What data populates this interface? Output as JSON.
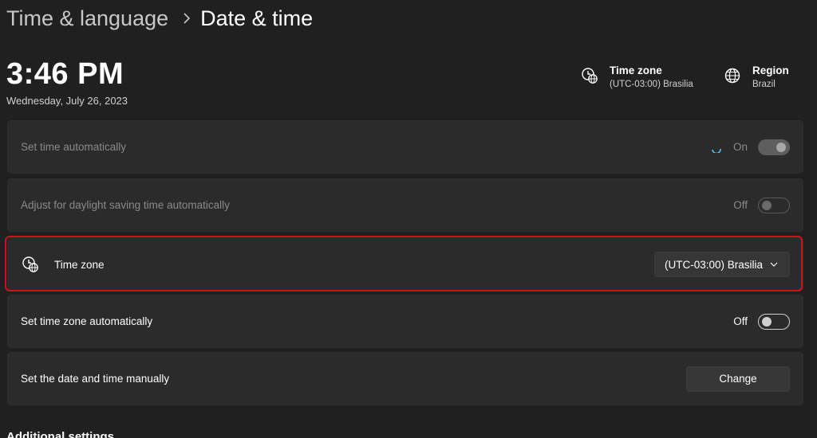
{
  "breadcrumb": {
    "parent": "Time & language",
    "current": "Date & time"
  },
  "clock": {
    "time": "3:46 PM",
    "date": "Wednesday, July 26, 2023"
  },
  "summary": {
    "time_zone": {
      "title": "Time zone",
      "value": "(UTC-03:00) Brasilia",
      "icon": "clock-globe-icon"
    },
    "region": {
      "title": "Region",
      "value": "Brazil",
      "icon": "globe-icon"
    }
  },
  "settings": {
    "set_time_auto": {
      "label": "Set time automatically",
      "state": "On",
      "enabled": false
    },
    "daylight_saving": {
      "label": "Adjust for daylight saving time automatically",
      "state": "Off",
      "enabled": false
    },
    "time_zone": {
      "label": "Time zone",
      "selected": "(UTC-03:00) Brasilia",
      "icon": "clock-globe-icon"
    },
    "set_tz_auto": {
      "label": "Set time zone automatically",
      "state": "Off",
      "enabled": true
    },
    "set_manual": {
      "label": "Set the date and time manually",
      "button": "Change"
    }
  },
  "additional": {
    "heading": "Additional settings"
  },
  "colors": {
    "background": "#202020",
    "card": "#2b2b2b",
    "highlight": "#d0121b",
    "spinner": "#4cc2ff"
  }
}
